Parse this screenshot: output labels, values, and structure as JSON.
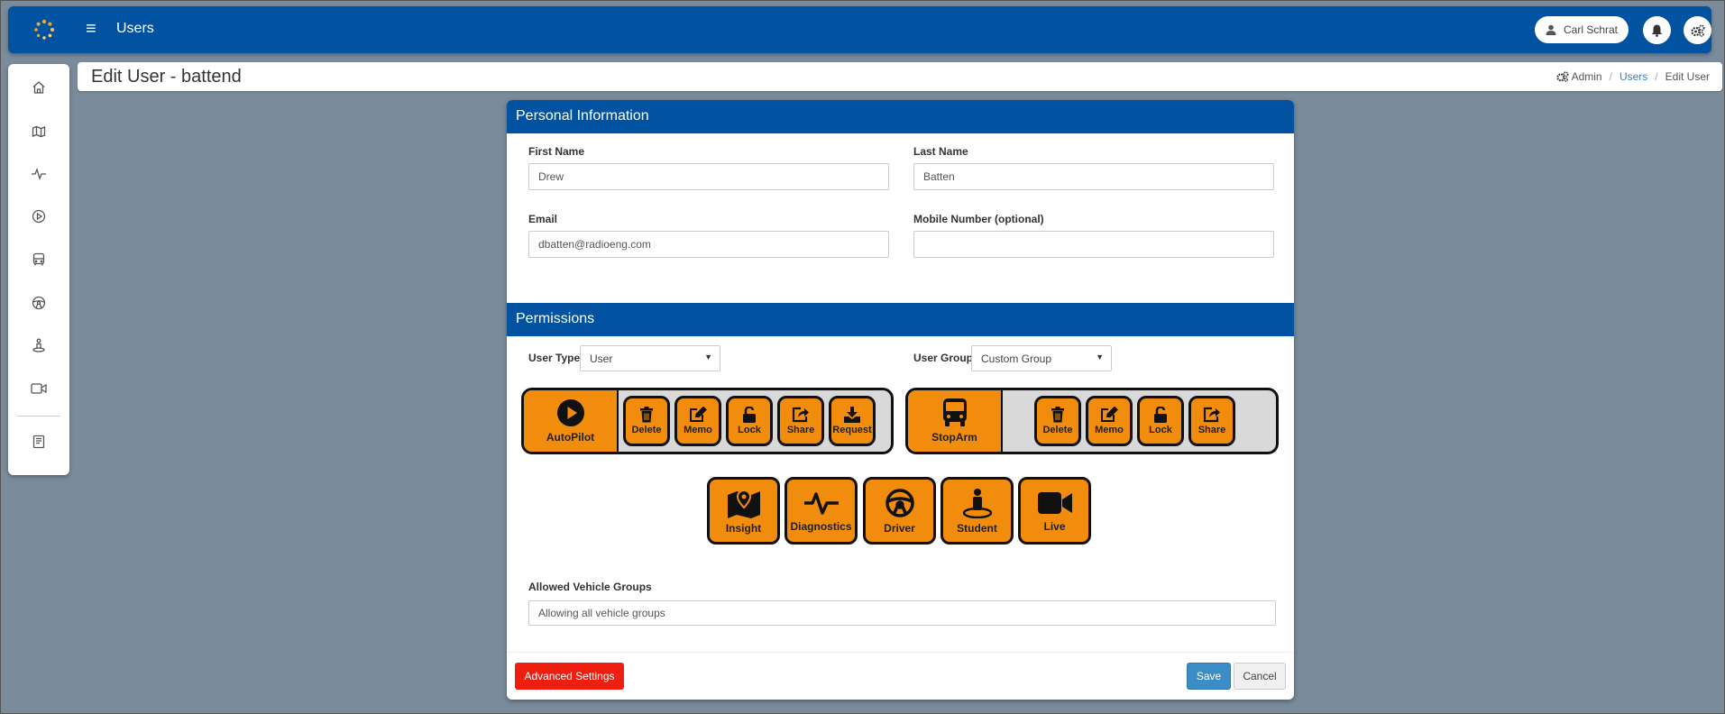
{
  "app": {
    "title": "Users",
    "user_name": "Carl Schrat"
  },
  "sidebar": {
    "items": [
      {
        "icon": "home-icon"
      },
      {
        "icon": "map-icon"
      },
      {
        "icon": "pulse-icon"
      },
      {
        "icon": "play-icon"
      },
      {
        "icon": "bus-icon"
      },
      {
        "icon": "steering-wheel-icon"
      },
      {
        "icon": "person-pin-icon"
      },
      {
        "icon": "video-icon"
      },
      {
        "icon": "book-icon"
      }
    ]
  },
  "page": {
    "title": "Edit User - battend",
    "breadcrumb": {
      "admin": "Admin",
      "users": "Users",
      "current": "Edit User"
    }
  },
  "personal": {
    "header": "Personal Information",
    "first_name_label": "First Name",
    "first_name_value": "Drew",
    "last_name_label": "Last Name",
    "last_name_value": "Batten",
    "email_label": "Email",
    "email_value": "dbatten@radioeng.com",
    "mobile_label": "Mobile Number (optional)",
    "mobile_value": ""
  },
  "permissions": {
    "header": "Permissions",
    "user_type_label": "User Type",
    "user_type_value": "User",
    "user_group_label": "User Group",
    "user_group_value": "Custom Group",
    "autopilot": {
      "label": "AutoPilot",
      "actions": [
        "Delete",
        "Memo",
        "Lock",
        "Share",
        "Request"
      ]
    },
    "stoparm": {
      "label": "StopArm",
      "actions": [
        "Delete",
        "Memo",
        "Lock",
        "Share"
      ]
    },
    "modules": [
      "Insight",
      "Diagnostics",
      "Driver",
      "Student",
      "Live"
    ],
    "vehicle_groups_label": "Allowed Vehicle Groups",
    "vehicle_groups_value": "Allowing all vehicle groups"
  },
  "footer": {
    "advanced_label": "Advanced Settings",
    "save_label": "Save",
    "cancel_label": "Cancel"
  },
  "colors": {
    "brand": "#0152a0",
    "permission_on": "#f28c0c",
    "danger": "#ee1e10",
    "primary": "#3c8dc5"
  }
}
